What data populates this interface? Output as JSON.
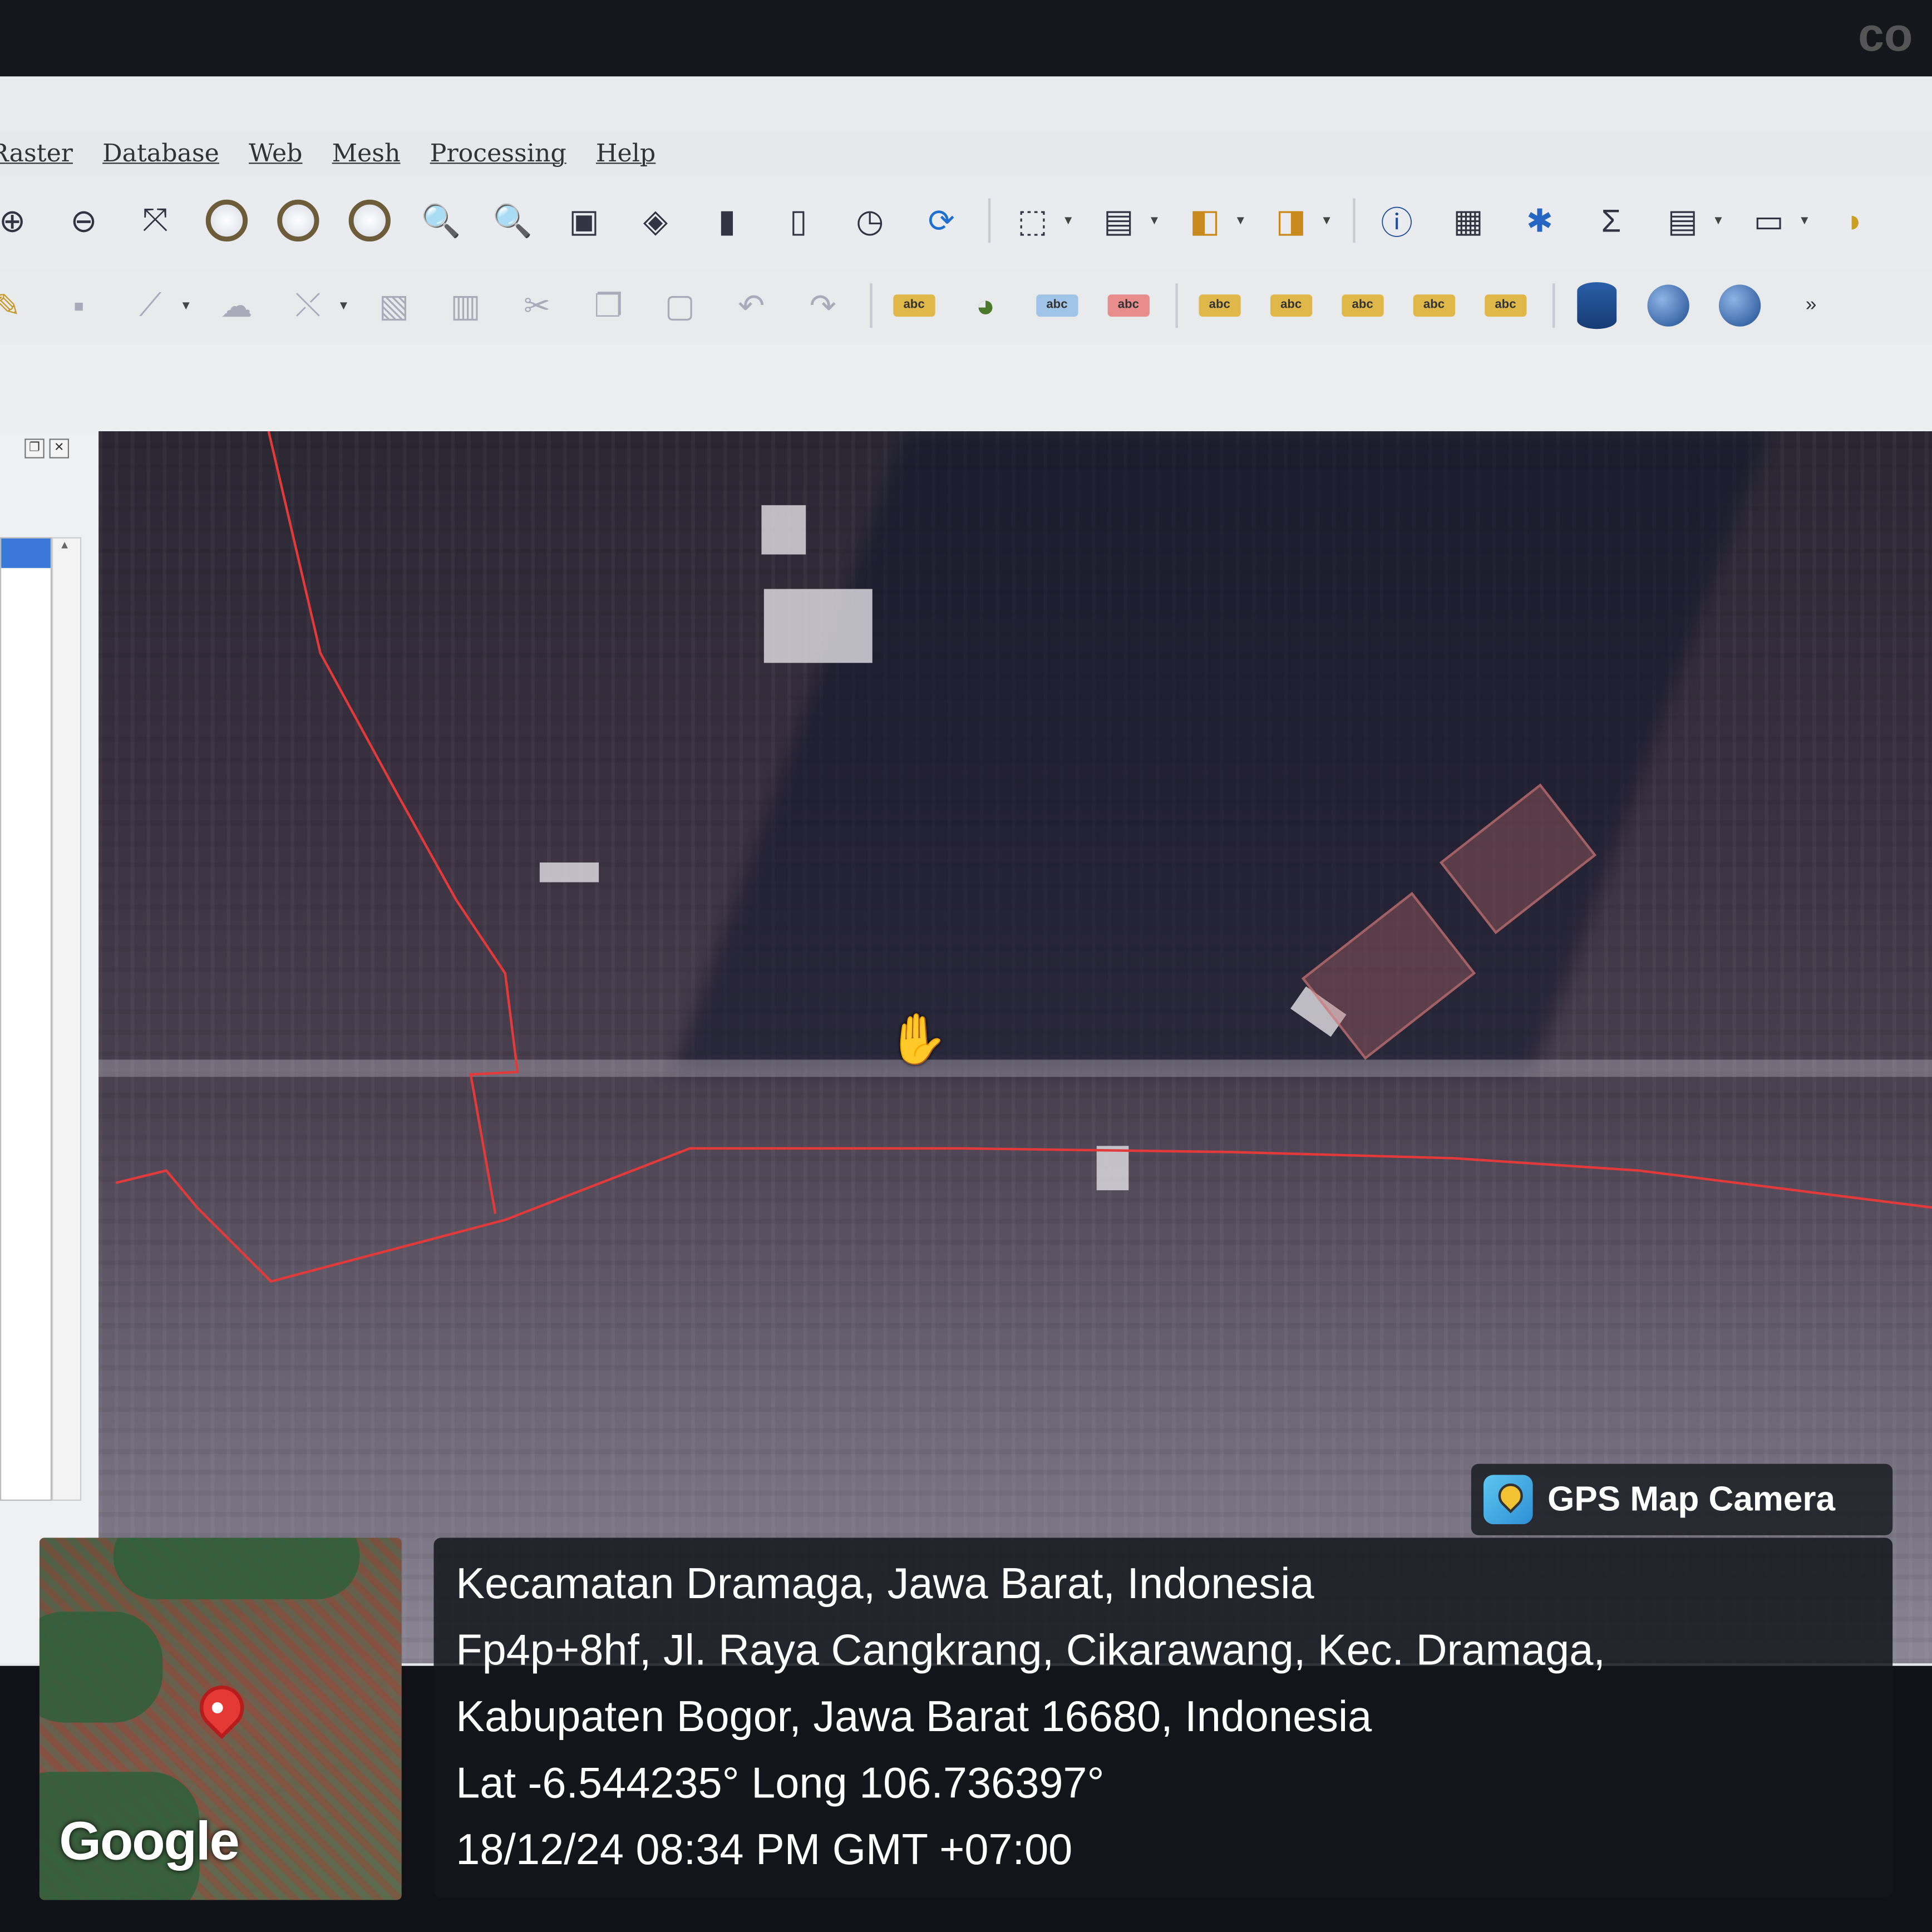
{
  "menu": [
    "Raster",
    "Database",
    "Web",
    "Mesh",
    "Processing",
    "Help"
  ],
  "toolbar_more": "»",
  "map": {
    "boundary_color": "#e23a3a"
  },
  "gps_camera": {
    "badge_label": "GPS Map Camera",
    "location_title": "Kecamatan Dramaga, Jawa Barat, Indonesia",
    "address_line1": "Fp4p+8hf, Jl. Raya Cangkrang, Cikarawang, Kec. Dramaga,",
    "address_line2": "Kabupaten Bogor, Jawa Barat 16680, Indonesia",
    "coordinates": "Lat -6.544235° Long 106.736397°",
    "datetime": "18/12/24 08:34 PM GMT +07:00",
    "map_provider": "Google"
  }
}
